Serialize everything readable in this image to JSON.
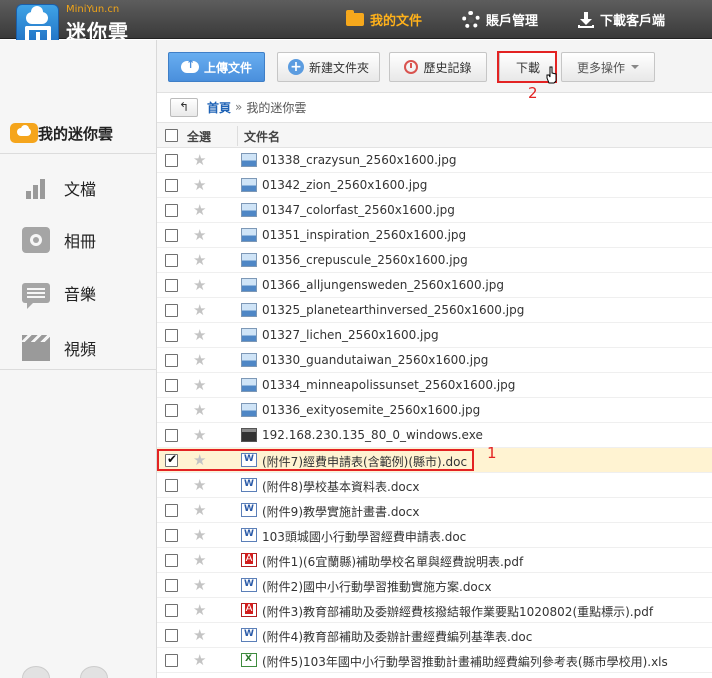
{
  "brand": {
    "url": "MiniYun.cn",
    "name": "迷你雲"
  },
  "topnav": {
    "files": "我的文件",
    "account": "賬戶管理",
    "download_client": "下載客戶端"
  },
  "sidebar": {
    "main": "我的迷你雲",
    "items": [
      {
        "label": "文檔",
        "icon": "bar-chart-icon"
      },
      {
        "label": "相冊",
        "icon": "camera-icon"
      },
      {
        "label": "音樂",
        "icon": "message-icon"
      },
      {
        "label": "視頻",
        "icon": "clapperboard-icon"
      }
    ]
  },
  "toolbar": {
    "upload": "上傳文件",
    "new_folder": "新建文件夾",
    "history": "歷史記錄",
    "download": "下載",
    "more": "更多操作"
  },
  "annotations": {
    "label_1": "1",
    "label_2": "2",
    "highlight_color": "#e32323"
  },
  "breadcrumb": {
    "back": "↰",
    "home": "首頁",
    "sep": "»",
    "current": "我的迷你雲"
  },
  "list": {
    "select_all": "全選",
    "name_header": "文件名",
    "rows": [
      {
        "name": "01338_crazysun_2560x1600.jpg",
        "type": "jpg",
        "checked": false
      },
      {
        "name": "01342_zion_2560x1600.jpg",
        "type": "jpg",
        "checked": false
      },
      {
        "name": "01347_colorfast_2560x1600.jpg",
        "type": "jpg",
        "checked": false
      },
      {
        "name": "01351_inspiration_2560x1600.jpg",
        "type": "jpg",
        "checked": false
      },
      {
        "name": "01356_crepuscule_2560x1600.jpg",
        "type": "jpg",
        "checked": false
      },
      {
        "name": "01366_alljungensweden_2560x1600.jpg",
        "type": "jpg",
        "checked": false
      },
      {
        "name": "01325_planetearthinversed_2560x1600.jpg",
        "type": "jpg",
        "checked": false
      },
      {
        "name": "01327_lichen_2560x1600.jpg",
        "type": "jpg",
        "checked": false
      },
      {
        "name": "01330_guandutaiwan_2560x1600.jpg",
        "type": "jpg",
        "checked": false
      },
      {
        "name": "01334_minneapolissunset_2560x1600.jpg",
        "type": "jpg",
        "checked": false
      },
      {
        "name": "01336_exityosemite_2560x1600.jpg",
        "type": "jpg",
        "checked": false
      },
      {
        "name": "192.168.230.135_80_0_windows.exe",
        "type": "exe",
        "checked": false
      },
      {
        "name": "(附件7)經費申請表(含範例)(縣市).doc",
        "type": "doc",
        "checked": true
      },
      {
        "name": "(附件8)學校基本資料表.docx",
        "type": "doc",
        "checked": false
      },
      {
        "name": "(附件9)教學實施計畫書.docx",
        "type": "doc",
        "checked": false
      },
      {
        "name": "103頭城國小行動學習經費申請表.doc",
        "type": "doc",
        "checked": false
      },
      {
        "name": "(附件1)(6宜蘭縣)補助學校名單與經費說明表.pdf",
        "type": "pdf",
        "checked": false
      },
      {
        "name": "(附件2)國中小行動學習推動實施方案.docx",
        "type": "doc",
        "checked": false
      },
      {
        "name": "(附件3)教育部補助及委辦經費核撥結報作業要點1020802(重點標示).pdf",
        "type": "pdf",
        "checked": false
      },
      {
        "name": "(附件4)教育部補助及委辦計畫經費編列基準表.doc",
        "type": "doc",
        "checked": false
      },
      {
        "name": "(附件5)103年國中小行動學習推動計畫補助經費編列參考表(縣市學校用).xls",
        "type": "xls",
        "checked": false
      }
    ]
  }
}
